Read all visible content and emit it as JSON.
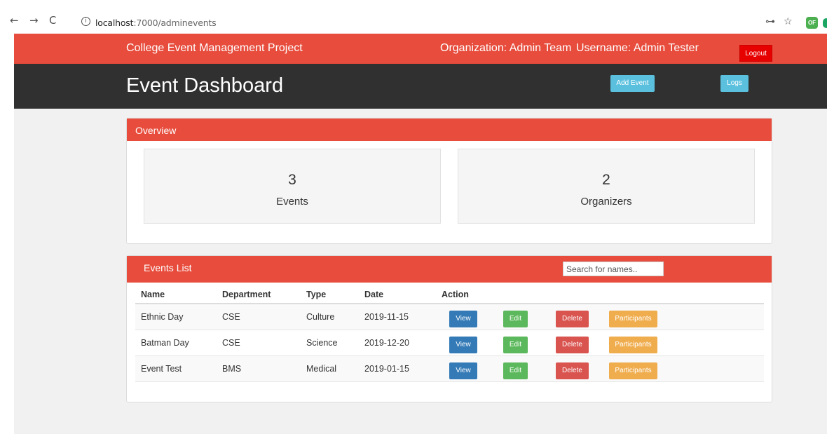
{
  "browser": {
    "back_icon": "←",
    "forward_icon": "→",
    "reload_icon": "C",
    "info_icon": "i",
    "url_host": "localhost",
    "url_path": ":7000/adminevents",
    "key_icon": "⊶",
    "star_icon": "☆",
    "ext_label": "OF"
  },
  "topnav": {
    "brand": "College Event Management Project",
    "organization": "Organization: Admin Team",
    "username": "Username: Admin Tester",
    "logout_label": "Logout"
  },
  "header": {
    "title": "Event Dashboard",
    "add_event_label": "Add Event",
    "logs_label": "Logs"
  },
  "overview": {
    "heading": "Overview",
    "stats": [
      {
        "value": "3",
        "label": "Events"
      },
      {
        "value": "2",
        "label": "Organizers"
      }
    ]
  },
  "events_list": {
    "heading": "Events List",
    "search_placeholder": "Search for names..",
    "columns": [
      "Name",
      "Department",
      "Type",
      "Date",
      "Action"
    ],
    "rows": [
      {
        "name": "Ethnic Day",
        "department": "CSE",
        "type": "Culture",
        "date": "2019-11-15"
      },
      {
        "name": "Batman Day",
        "department": "CSE",
        "type": "Science",
        "date": "2019-12-20"
      },
      {
        "name": "Event Test",
        "department": "BMS",
        "type": "Medical",
        "date": "2019-01-15"
      }
    ],
    "actions": {
      "view": "View",
      "edit": "Edit",
      "delete": "Delete",
      "participants": "Participants"
    }
  },
  "colors": {
    "accent_red": "#e74c3c",
    "header_dark": "#303030",
    "info_blue": "#5bc0de",
    "primary_blue": "#337ab7",
    "success_green": "#5cb85c",
    "danger_red": "#d9534f",
    "warning_orange": "#f0ad4e"
  }
}
